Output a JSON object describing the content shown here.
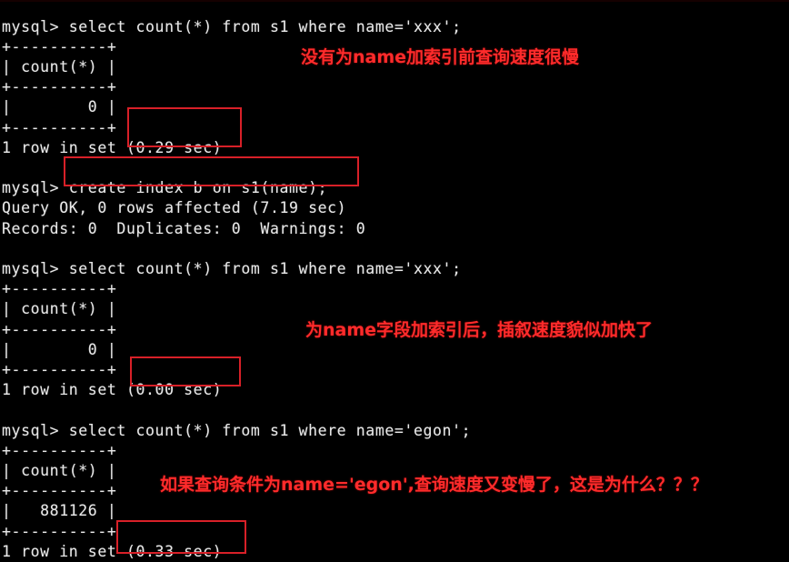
{
  "window": {
    "title": "mysql command line client",
    "background_color": "#000000",
    "text_color": "#e8e8e8",
    "annotation_color": "#ff2b2b",
    "box_color": "#d82028"
  },
  "terminal": {
    "lines": [
      "mysql> select count(*) from s1 where name='xxx';",
      "+----------+",
      "| count(*) |",
      "+----------+",
      "|        0 |",
      "+----------+",
      "1 row in set (0.29 sec)",
      "",
      "mysql> create index b on s1(name);",
      "Query OK, 0 rows affected (7.19 sec)",
      "Records: 0  Duplicates: 0  Warnings: 0",
      "",
      "mysql> select count(*) from s1 where name='xxx';",
      "+----------+",
      "| count(*) |",
      "+----------+",
      "|        0 |",
      "+----------+",
      "1 row in set (0.00 sec)",
      "",
      "mysql> select count(*) from s1 where name='egon';",
      "+----------+",
      "| count(*) |",
      "+----------+",
      "|   881126 |",
      "+----------+",
      "1 row in set (0.33 sec)"
    ],
    "prompt": "mysql>",
    "queries": [
      "select count(*) from s1 where name='xxx';",
      "create index b on s1(name);",
      "select count(*) from s1 where name='xxx';",
      "select count(*) from s1 where name='egon';"
    ],
    "results": [
      {
        "column": "count(*)",
        "value": "0",
        "rows": "1 row in set",
        "time": "(0.29 sec)"
      },
      {
        "column": "count(*)",
        "value": "0",
        "rows": "1 row in set",
        "time": "(0.00 sec)"
      },
      {
        "column": "count(*)",
        "value": "881126",
        "rows": "1 row in set",
        "time": "(0.33 sec)"
      }
    ],
    "create_index_status": "Query OK, 0 rows affected (7.19 sec)",
    "create_index_records": "Records: 0  Duplicates: 0  Warnings: 0"
  },
  "annotations": {
    "note1": "没有为name加索引前查询速度很慢",
    "note2": "为name字段加索引后，插叙速度貌似加快了",
    "note3": "如果查询条件为name='egon',查询速度又变慢了，这是为什么？？？"
  },
  "highlight_boxes": [
    {
      "label": "(0.29 sec)"
    },
    {
      "label": "create index b on s1(name);"
    },
    {
      "label": "(0.00 sec)"
    },
    {
      "label": "(0.33 sec)"
    }
  ]
}
